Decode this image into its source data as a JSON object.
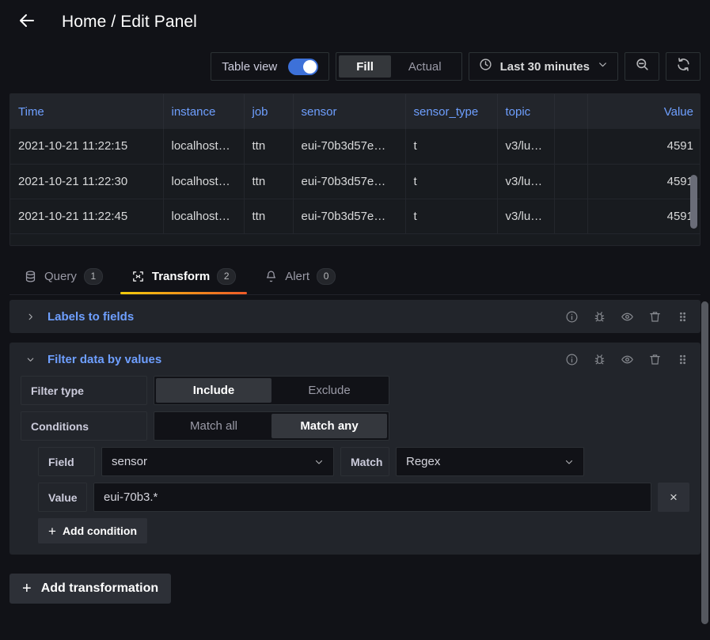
{
  "header": {
    "back_icon": "arrow-left-icon",
    "title": "Home / Edit Panel"
  },
  "toolbar": {
    "table_view_label": "Table view",
    "table_view_on": true,
    "display_modes": [
      {
        "label": "Fill",
        "active": true
      },
      {
        "label": "Actual",
        "active": false
      }
    ],
    "time_range": "Last 30 minutes",
    "clock_icon": "clock-icon",
    "time_chevron_icon": "chevron-down-icon",
    "zoom_out_icon": "zoom-out-icon",
    "refresh_icon": "refresh-icon"
  },
  "table": {
    "columns": [
      {
        "name": "Time",
        "align": "left"
      },
      {
        "name": "instance",
        "align": "left"
      },
      {
        "name": "job",
        "align": "left"
      },
      {
        "name": "sensor",
        "align": "left"
      },
      {
        "name": "sensor_type",
        "align": "left"
      },
      {
        "name": "topic",
        "align": "left"
      },
      {
        "name": "",
        "align": "left"
      },
      {
        "name": "Value",
        "align": "right"
      }
    ],
    "rows": [
      [
        "2021-10-21 11:22:15",
        "localhost…",
        "ttn",
        "eui-70b3d57e…",
        "t",
        "v3/lu…",
        "",
        "4591"
      ],
      [
        "2021-10-21 11:22:30",
        "localhost…",
        "ttn",
        "eui-70b3d57e…",
        "t",
        "v3/lu…",
        "",
        "4591"
      ],
      [
        "2021-10-21 11:22:45",
        "localhost…",
        "ttn",
        "eui-70b3d57e…",
        "t",
        "v3/lu…",
        "",
        "4591"
      ]
    ]
  },
  "tabs": [
    {
      "label": "Query",
      "badge": "1",
      "icon": "database-icon",
      "active": false
    },
    {
      "label": "Transform",
      "badge": "2",
      "icon": "transform-icon",
      "active": true
    },
    {
      "label": "Alert",
      "badge": "0",
      "icon": "bell-icon",
      "active": false
    }
  ],
  "transformations": [
    {
      "title": "Labels to fields",
      "expanded": false,
      "chevron_icon": "chevron-right-icon",
      "actions": [
        "info-icon",
        "debug-icon",
        "eye-icon",
        "trash-icon",
        "drag-handle-icon"
      ]
    },
    {
      "title": "Filter data by values",
      "expanded": true,
      "chevron_icon": "chevron-down-icon",
      "actions": [
        "info-icon",
        "debug-icon",
        "eye-icon",
        "trash-icon",
        "drag-handle-icon"
      ],
      "filter_type": {
        "label": "Filter type",
        "options": [
          {
            "label": "Include",
            "active": true
          },
          {
            "label": "Exclude",
            "active": false
          }
        ]
      },
      "conditions_mode": {
        "label": "Conditions",
        "options": [
          {
            "label": "Match all",
            "active": false
          },
          {
            "label": "Match any",
            "active": true
          }
        ]
      },
      "condition": {
        "field_label": "Field",
        "field_value": "sensor",
        "match_label": "Match",
        "match_value": "Regex",
        "value_label": "Value",
        "value_value": "eui-70b3.*",
        "value_placeholder": "Value",
        "remove_label": "×"
      },
      "add_condition_label": "Add condition"
    }
  ],
  "add_transformation_label": "Add transformation",
  "colors": {
    "background": "#111217",
    "panel": "#181b1f",
    "accent_blue": "#6e9fff",
    "toggle_on": "#3d71d9",
    "tab_underline_start": "#f2cc0c",
    "tab_underline_end": "#f05a28"
  }
}
